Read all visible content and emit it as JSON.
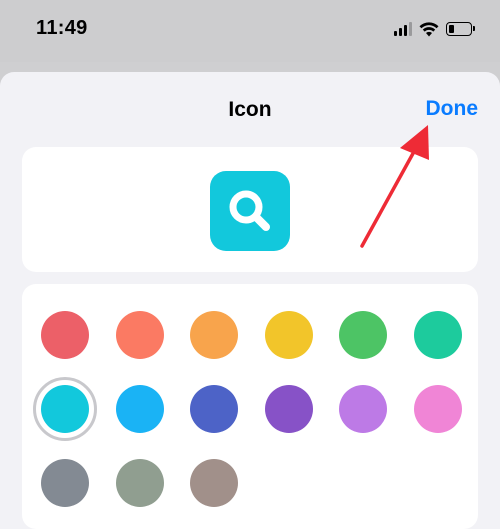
{
  "status_bar": {
    "time": "11:49",
    "battery_level": 0.25,
    "icons": [
      "cellular-signal-icon",
      "wifi-icon",
      "battery-icon"
    ]
  },
  "sheet": {
    "title": "Icon",
    "done_label": "Done",
    "accent_color": "#0a7cff"
  },
  "preview": {
    "icon": "magnifying-glass-icon",
    "color": "#12c8dc"
  },
  "colors": {
    "selected_index": 6,
    "swatches": [
      "#ec6068",
      "#fb7a63",
      "#f8a44c",
      "#f2c52a",
      "#4dc465",
      "#1dcb9d",
      "#12c8dc",
      "#1ab3f5",
      "#4d63c7",
      "#8752c7",
      "#bd7ae6",
      "#f085d6",
      "#838a93",
      "#909e90",
      "#a1908a"
    ]
  },
  "annotation": {
    "color": "#ee2b36"
  }
}
